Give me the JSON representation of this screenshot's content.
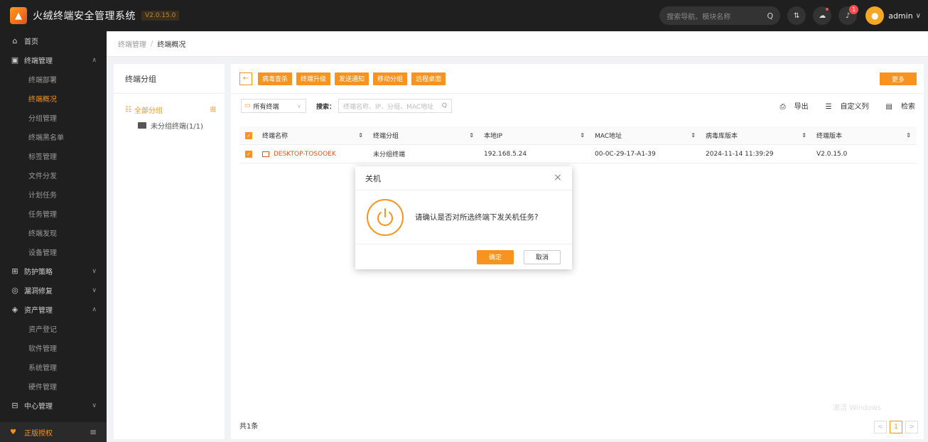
{
  "app": {
    "title": "火绒终端安全管理系统",
    "version": "V2.0.15.0",
    "logo_icon": "flame-logo-icon"
  },
  "topbar": {
    "search_placeholder": "搜索导航、模块名称",
    "search_icon": "Q",
    "sort_icon": "⇅",
    "cloud_icon": "☁",
    "bell_icon": "🔔",
    "notification_count": "1",
    "user": "admin",
    "caret": "∨"
  },
  "sidebar": {
    "items": [
      {
        "label": "首页",
        "icon": "⌂",
        "type": "top"
      },
      {
        "label": "终端管理",
        "icon": "▣",
        "type": "top",
        "arrow": "∧"
      },
      {
        "label": "终端部署",
        "type": "sub"
      },
      {
        "label": "终端概况",
        "type": "sub",
        "active": true
      },
      {
        "label": "分组管理",
        "type": "sub"
      },
      {
        "label": "终端黑名单",
        "type": "sub"
      },
      {
        "label": "标签管理",
        "type": "sub"
      },
      {
        "label": "文件分发",
        "type": "sub"
      },
      {
        "label": "计划任务",
        "type": "sub"
      },
      {
        "label": "任务管理",
        "type": "sub"
      },
      {
        "label": "终端发现",
        "type": "sub"
      },
      {
        "label": "设备管理",
        "type": "sub"
      },
      {
        "label": "防护策略",
        "icon": "⊞",
        "type": "top",
        "arrow": "∨"
      },
      {
        "label": "漏洞修复",
        "icon": "◎",
        "type": "top",
        "arrow": "∨"
      },
      {
        "label": "资产管理",
        "icon": "◈",
        "type": "top",
        "arrow": "∧"
      },
      {
        "label": "资产登记",
        "type": "sub"
      },
      {
        "label": "软件管理",
        "type": "sub"
      },
      {
        "label": "系统管理",
        "type": "sub"
      },
      {
        "label": "硬件管理",
        "type": "sub"
      },
      {
        "label": "中心管理",
        "icon": "⊟",
        "type": "top",
        "arrow": "∨"
      }
    ],
    "bottom_label": "正版授权",
    "bottom_icon": "♥",
    "menu_icon": "≡"
  },
  "breadcrumb": {
    "parent": "终端管理",
    "separator": "/",
    "current": "终端概况"
  },
  "group_panel": {
    "title": "终端分组",
    "all_label": "全部分组",
    "all_icon": "☷",
    "collapse_icon": "⊞",
    "child_label": "未分组终端(1/1)"
  },
  "toolbar": {
    "back_icon": "←",
    "buttons": [
      "病毒查杀",
      "终端升级",
      "发送通知",
      "移动分组",
      "远程桌面"
    ],
    "more": "更多"
  },
  "filter": {
    "select_label": "所有终端",
    "select_icon": "▭",
    "dropdown_icon": "∨",
    "search_label": "搜索：",
    "search_placeholder": "终端名称、IP、分组、MAC地址",
    "search_icon": "Q",
    "export": "导出",
    "export_icon": "⎙",
    "custom_columns": "自定义列",
    "custom_icon": "☰",
    "retrieve": "检索",
    "retrieve_icon": "▤"
  },
  "table": {
    "columns": [
      "终端名称",
      "终端分组",
      "本地IP",
      "MAC地址",
      "病毒库版本",
      "终端版本"
    ],
    "sort_icon": "⇕",
    "check_icon": "✓",
    "rows": [
      {
        "name": "DESKTOP-TOSOOEK",
        "group": "未分组终端",
        "ip": "192.168.5.24",
        "mac": "00-0C-29-17-A1-39",
        "virus_db": "2024-11-14 11:39:29",
        "version": "V2.0.15.0"
      }
    ]
  },
  "footer": {
    "total": "共1条",
    "prev": "<",
    "page": "1",
    "next": ">",
    "watermark": "激活 Windows"
  },
  "dialog": {
    "title": "关机",
    "close": "×",
    "message": "请确认是否对所选终端下发关机任务?",
    "ok": "确定",
    "cancel": "取消",
    "icon": "power-icon",
    "accent": "#f7931e"
  },
  "colors": {
    "accent": "#f7931e",
    "sidebar_bg": "#1f1f1f",
    "host_red": "#e0531b"
  }
}
